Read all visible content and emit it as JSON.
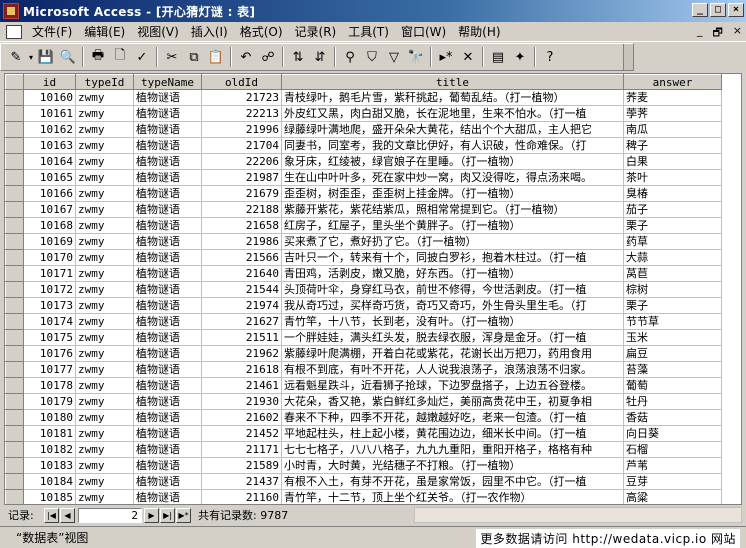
{
  "window": {
    "title": "Microsoft Access - [开心猜灯谜 : 表]"
  },
  "menu": [
    {
      "label": "文件(F)",
      "name": "file"
    },
    {
      "label": "编辑(E)",
      "name": "edit"
    },
    {
      "label": "视图(V)",
      "name": "view"
    },
    {
      "label": "插入(I)",
      "name": "insert"
    },
    {
      "label": "格式(O)",
      "name": "format"
    },
    {
      "label": "记录(R)",
      "name": "records"
    },
    {
      "label": "工具(T)",
      "name": "tools"
    },
    {
      "label": "窗口(W)",
      "name": "window"
    },
    {
      "label": "帮助(H)",
      "name": "help"
    }
  ],
  "mdi_buttons": [
    "_",
    "🗗",
    "×"
  ],
  "toolbar": [
    {
      "name": "design-view-icon",
      "glyph": "✎"
    },
    {
      "name": "save-icon",
      "glyph": "💾"
    },
    {
      "name": "search-icon",
      "glyph": "🔍"
    },
    {
      "name": "print-icon",
      "glyph": "🖶"
    },
    {
      "name": "print-preview-icon",
      "glyph": "🗋"
    },
    {
      "name": "spelling-icon",
      "glyph": "✓"
    },
    {
      "name": "cut-icon",
      "glyph": "✂"
    },
    {
      "name": "copy-icon",
      "glyph": "⧉"
    },
    {
      "name": "paste-icon",
      "glyph": "📋"
    },
    {
      "name": "undo-icon",
      "glyph": "↶"
    },
    {
      "name": "hyperlink-icon",
      "glyph": "☍"
    },
    {
      "name": "sort-ascending-icon",
      "glyph": "⇅"
    },
    {
      "name": "sort-descending-icon",
      "glyph": "⇵"
    },
    {
      "name": "filter-by-selection-icon",
      "glyph": "⚲"
    },
    {
      "name": "filter-by-form-icon",
      "glyph": "⛉"
    },
    {
      "name": "apply-filter-icon",
      "glyph": "▽"
    },
    {
      "name": "find-icon",
      "glyph": "🔭"
    },
    {
      "name": "new-record-icon",
      "glyph": "▸*"
    },
    {
      "name": "delete-record-icon",
      "glyph": "✕"
    },
    {
      "name": "database-window-icon",
      "glyph": "▤"
    },
    {
      "name": "new-object-icon",
      "glyph": "✦"
    },
    {
      "name": "help-icon",
      "glyph": "?"
    }
  ],
  "table": {
    "columns": [
      {
        "key": "id",
        "label": "id",
        "width": 52,
        "cls": "num"
      },
      {
        "key": "typeId",
        "label": "typeId",
        "width": 58,
        "cls": "mono"
      },
      {
        "key": "typeName",
        "label": "typeName",
        "width": 68,
        "cls": ""
      },
      {
        "key": "oldId",
        "label": "oldId",
        "width": 80,
        "cls": "num"
      },
      {
        "key": "title",
        "label": "title",
        "width": 342,
        "cls": ""
      },
      {
        "key": "answer",
        "label": "answer",
        "width": 98,
        "cls": ""
      }
    ],
    "rows": [
      [
        "10160",
        "zwmy",
        "植物谜语",
        "21723",
        "青枝绿叶，鹅毛片雪，紫秆挑起，葡萄乱结。（打一植物）",
        "荞麦"
      ],
      [
        "10161",
        "zwmy",
        "植物谜语",
        "22213",
        "外皮红又黑，肉白甜又脆，长在泥地里，生来不怕水。（打一植",
        "荸荠"
      ],
      [
        "10162",
        "zwmy",
        "植物谜语",
        "21996",
        "绿藤绿叶满地爬，盛开朵朵大黄花，结出个个大甜瓜，主人把它",
        "南瓜"
      ],
      [
        "10163",
        "zwmy",
        "植物谜语",
        "21704",
        "同妻书，同室考，我的文章比伊好，有人识破，性命难保。（打",
        "稗子"
      ],
      [
        "10164",
        "zwmy",
        "植物谜语",
        "22206",
        "象牙床，红绫被，绿官娘子在里睡。（打一植物）",
        "白果"
      ],
      [
        "10165",
        "zwmy",
        "植物谜语",
        "21987",
        "生在山中叶叶多，死在家中炒一窝，肉又没得吃，得点汤来喝。",
        "茶叶"
      ],
      [
        "10166",
        "zwmy",
        "植物谜语",
        "21679",
        "歪歪树，树歪歪，歪歪树上挂金牌。（打一植物）",
        "臭椿"
      ],
      [
        "10167",
        "zwmy",
        "植物谜语",
        "22188",
        "紫藤开紫花，紫花结紫瓜，照相常常提到它。（打一植物）",
        "茄子"
      ],
      [
        "10168",
        "zwmy",
        "植物谜语",
        "21658",
        "红房子，红屋子，里头坐个黄胖子。（打一植物）",
        "栗子"
      ],
      [
        "10169",
        "zwmy",
        "植物谜语",
        "21986",
        "买来煮了它，煮好扔了它。（打一植物）",
        "药草"
      ],
      [
        "10170",
        "zwmy",
        "植物谜语",
        "21566",
        "吉叶只一个，转来有十个，同披白罗衫，抱着木柱过。（打一植",
        "大蒜"
      ],
      [
        "10171",
        "zwmy",
        "植物谜语",
        "21640",
        "青田鸡，活剥皮，嫩又脆，好东西。（打一植物）",
        "莴苣"
      ],
      [
        "10172",
        "zwmy",
        "植物谜语",
        "21544",
        "头顶荷叶伞，身穿红马衣，前世不修得，今世活剥皮。（打一植",
        "棕树"
      ],
      [
        "10173",
        "zwmy",
        "植物谜语",
        "21974",
        "我从奇巧过，买样奇巧货，奇巧又奇巧，外生骨头里生毛。（打",
        "栗子"
      ],
      [
        "10174",
        "zwmy",
        "植物谜语",
        "21627",
        "青竹竿，十八节，长到老，没有叶。（打一植物）",
        "节节草"
      ],
      [
        "10175",
        "zwmy",
        "植物谜语",
        "21511",
        "一个胖娃娃，满头红头发，脱去绿衣服，浑身是金牙。（打一植",
        "玉米"
      ],
      [
        "10176",
        "zwmy",
        "植物谜语",
        "21962",
        "紫藤绿叶爬满棚，开着白花或紫花，花谢长出万把刀，药用食用",
        "扁豆"
      ],
      [
        "10177",
        "zwmy",
        "植物谜语",
        "21618",
        "有根不到底，有叶不开花，人人说我浪荡子，浪荡浪荡不归家。",
        "苔藻"
      ],
      [
        "10178",
        "zwmy",
        "植物谜语",
        "21461",
        "远看魁星跌斗，近看狮子抢球，下边罗盘搭子，上边五谷登楼。",
        "葡萄"
      ],
      [
        "10179",
        "zwmy",
        "植物谜语",
        "21930",
        "大花朵，香又艳，紫白鲜红多灿烂，美丽高贵花中王，初夏争相",
        "牡丹"
      ],
      [
        "10180",
        "zwmy",
        "植物谜语",
        "21602",
        "春来不下种，四季不开花，越嫩越好吃，老来一包渣。（打一植",
        "香菇"
      ],
      [
        "10181",
        "zwmy",
        "植物谜语",
        "21452",
        "平地起柱头，柱上起小楼，黄花围边边，细米长中间。（打一植",
        "向日葵"
      ],
      [
        "10182",
        "zwmy",
        "植物谜语",
        "21171",
        "七七七格子，八八八格子，九九九重阳，重阳开格子，格格有种",
        "石榴"
      ],
      [
        "10183",
        "zwmy",
        "植物谜语",
        "21589",
        "小时青，大时黄，光结穗子不打粮。（打一植物）",
        "芦苇"
      ],
      [
        "10184",
        "zwmy",
        "植物谜语",
        "21437",
        "有根不入土，有芽不开花，虽是家常饭，园里不中它。（打一植",
        "豆芽"
      ],
      [
        "10185",
        "zwmy",
        "植物谜语",
        "21160",
        "青竹竿，十二节，顶上坐个红关爷。（打一农作物）",
        "高粱"
      ]
    ]
  },
  "nav": {
    "label": "记录:",
    "current": "2",
    "count_label": "共有记录数: 9787",
    "buttons": {
      "first": "|◀",
      "prev": "◀",
      "next": "▶",
      "last": "▶|",
      "new": "▶*"
    }
  },
  "status": {
    "left": "“数据表”视图",
    "right": "更多数据请访问 http://wedata.vicp.io 网站"
  }
}
